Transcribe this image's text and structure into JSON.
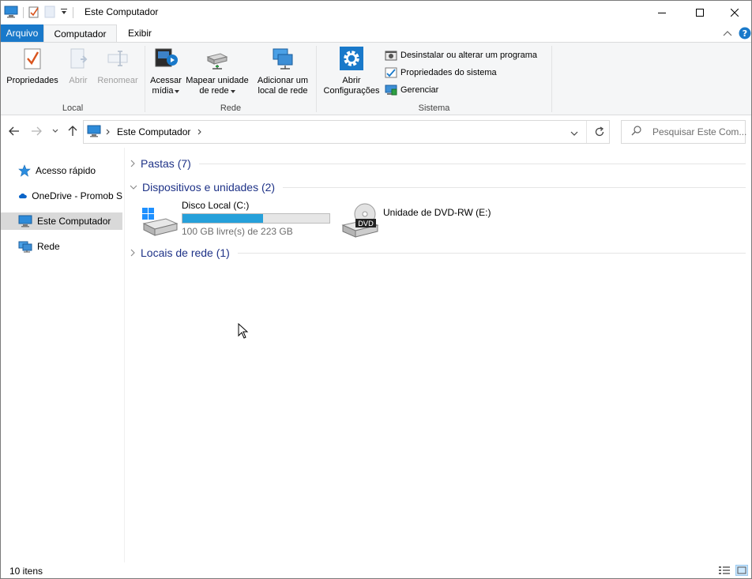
{
  "window": {
    "title": "Este Computador",
    "minimize_icon": "minimize-icon",
    "maximize_icon": "maximize-icon",
    "close_icon": "close-icon"
  },
  "ribbon_tabs": {
    "file": "Arquivo",
    "computer": "Computador",
    "view": "Exibir"
  },
  "ribbon": {
    "local": {
      "label": "Local",
      "properties": "Propriedades",
      "open": "Abrir",
      "rename": "Renomear"
    },
    "network": {
      "label": "Rede",
      "access_media_line1": "Acessar",
      "access_media_line2": "mídia",
      "map_drive_line1": "Mapear unidade",
      "map_drive_line2": "de rede",
      "add_location_line1": "Adicionar um",
      "add_location_line2": "local de rede"
    },
    "system": {
      "label": "Sistema",
      "open_settings_line1": "Abrir",
      "open_settings_line2": "Configurações",
      "uninstall": "Desinstalar ou alterar um programa",
      "system_properties": "Propriedades do sistema",
      "manage": "Gerenciar"
    }
  },
  "address": {
    "location": "Este Computador",
    "search_placeholder": "Pesquisar Este Com..."
  },
  "nav_pane": {
    "items": [
      {
        "label": "Acesso rápido"
      },
      {
        "label": "OneDrive - Promob S"
      },
      {
        "label": "Este Computador"
      },
      {
        "label": "Rede"
      }
    ]
  },
  "content": {
    "folders_group": "Pastas (7)",
    "devices_group": "Dispositivos e unidades (2)",
    "network_group": "Locais de rede (1)",
    "drives": [
      {
        "name": "Disco Local (C:)",
        "free": "100 GB livre(s) de 223 GB",
        "used_fraction": 0.55
      },
      {
        "name": "Unidade de DVD-RW (E:)",
        "badge": "DVD"
      }
    ]
  },
  "status": {
    "count": "10 itens"
  },
  "colors": {
    "accent": "#1979ca",
    "group_header": "#1e3287",
    "bar_fill": "#26a0da",
    "selection": "#d9d9d9"
  }
}
